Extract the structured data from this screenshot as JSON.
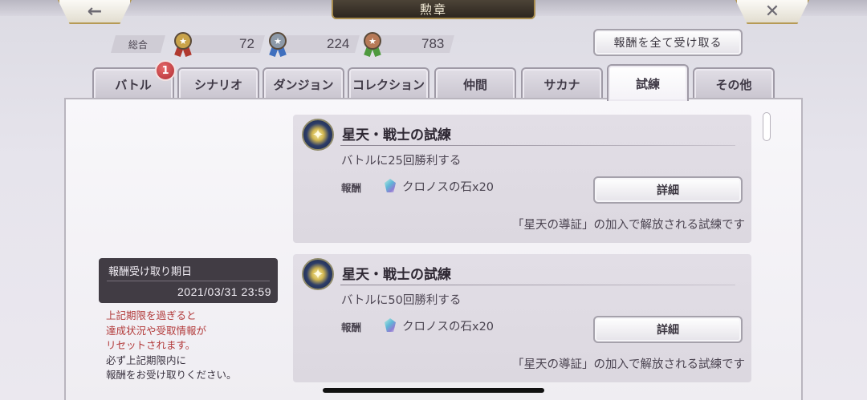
{
  "header": {
    "title": "勲章",
    "back_icon": "back-arrow-icon",
    "close_icon": "close-x-icon"
  },
  "summary": {
    "label": "総合",
    "medals": [
      {
        "tier": "gold",
        "count": "72",
        "color": "#c9a34a",
        "ribbon": "#b0392f"
      },
      {
        "tier": "silver",
        "count": "224",
        "color": "#8c99a8",
        "ribbon": "#3f6fbe"
      },
      {
        "tier": "bronze",
        "count": "783",
        "color": "#b77a58",
        "ribbon": "#4f9a3f"
      }
    ]
  },
  "claim_all_label": "報酬を全て受け取る",
  "tabs": [
    {
      "label": "バトル",
      "badge": "1"
    },
    {
      "label": "シナリオ"
    },
    {
      "label": "ダンジョン"
    },
    {
      "label": "コレクション"
    },
    {
      "label": "仲間"
    },
    {
      "label": "サカナ"
    },
    {
      "label": "試練",
      "active": true
    },
    {
      "label": "その他"
    }
  ],
  "deadline": {
    "title": "報酬受け取り期日",
    "date": "2021/03/31 23:59"
  },
  "notice": {
    "warning_lines": [
      "上記期限を過ぎると",
      "達成状況や受取情報が",
      "リセットされます。"
    ],
    "info_lines": [
      "必ず上記期限内に",
      "報酬をお受け取りください。"
    ]
  },
  "cards": [
    {
      "title": "星天・戦士の試練",
      "description": "バトルに25回勝利する",
      "reward_label": "報酬",
      "reward": "クロノスの石x20",
      "detail_label": "詳細",
      "unlock_text": "「星天の導証」の加入で解放される試練です"
    },
    {
      "title": "星天・戦士の試練",
      "description": "バトルに50回勝利する",
      "reward_label": "報酬",
      "reward": "クロノスの石x20",
      "detail_label": "詳細",
      "unlock_text": "「星天の導証」の加入で解放される試練です"
    }
  ]
}
